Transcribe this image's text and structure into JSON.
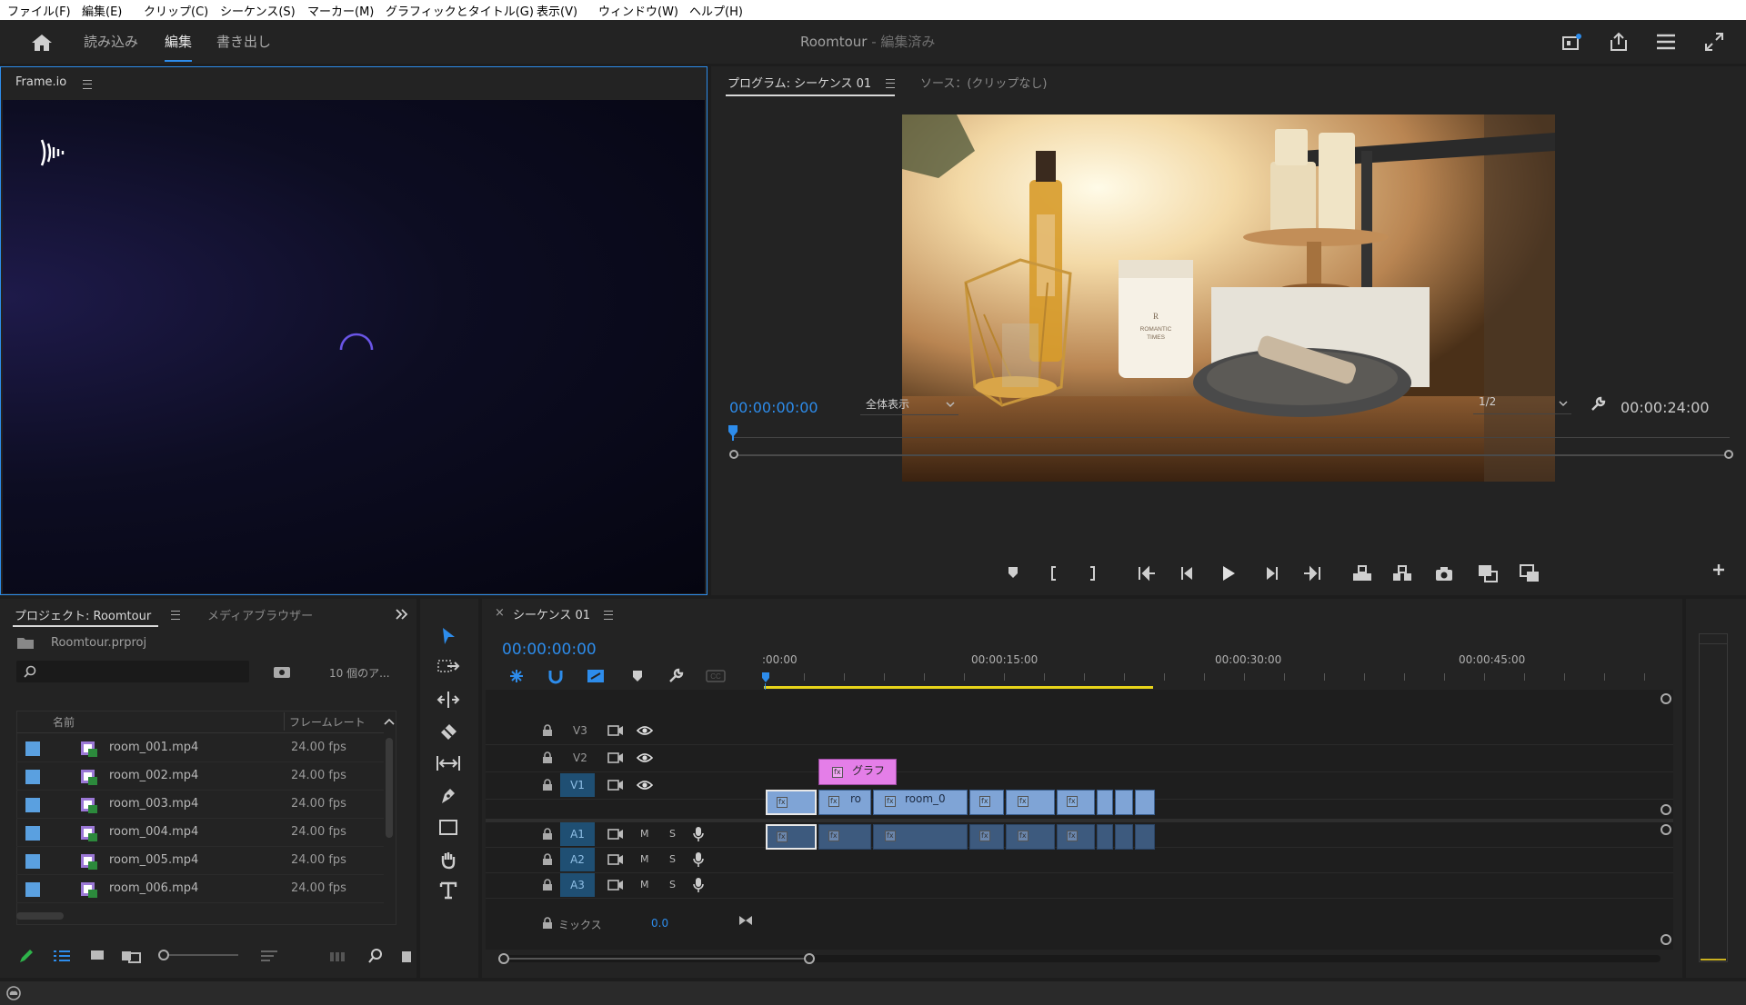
{
  "menu": [
    "ファイル(F)",
    "編集(E)",
    "クリップ(C)",
    "シーケンス(S)",
    "マーカー(M)",
    "グラフィックとタイトル(G)",
    "表示(V)",
    "ウィンドウ(W)",
    "ヘルプ(H)"
  ],
  "header": {
    "tabs": [
      "読み込み",
      "編集",
      "書き出し"
    ],
    "active_tab": "編集",
    "project_title": "Roomtour",
    "project_status": " - 編集済み"
  },
  "frameio": {
    "title": "Frame.io"
  },
  "program": {
    "tab_program": "プログラム: シーケンス 01",
    "tab_source": "ソース：(クリップなし)",
    "timecode": "00:00:00:00",
    "zoom": "全体表示",
    "resolution": "1/2",
    "duration": "00:00:24:00",
    "image_text": [
      "R",
      "ROMANTIC",
      "TIMES"
    ]
  },
  "project": {
    "tab_project": "プロジェクト: Roomtour",
    "tab_media": "メディアブラウザー",
    "file": "Roomtour.prproj",
    "item_count": "10 個のア...",
    "columns": [
      "名前",
      "フレームレート"
    ],
    "items": [
      {
        "name": "room_001.mp4",
        "fps": "24.00 fps"
      },
      {
        "name": "room_002.mp4",
        "fps": "24.00 fps"
      },
      {
        "name": "room_003.mp4",
        "fps": "24.00 fps"
      },
      {
        "name": "room_004.mp4",
        "fps": "24.00 fps"
      },
      {
        "name": "room_005.mp4",
        "fps": "24.00 fps"
      },
      {
        "name": "room_006.mp4",
        "fps": "24.00 fps"
      }
    ]
  },
  "timeline": {
    "tab": "シーケンス 01",
    "timecode": "00:00:00:00",
    "ruler": [
      ":00:00",
      "00:00:15:00",
      "00:00:30:00",
      "00:00:45:00"
    ],
    "video_tracks": [
      "V3",
      "V2",
      "V1"
    ],
    "audio_tracks": [
      "A1",
      "A2",
      "A3"
    ],
    "mix_label": "ミックス",
    "mix_value": "0.0",
    "graphic_clip": "グラフ",
    "clip_labels": [
      "ro",
      "room_0"
    ],
    "m_label": "M",
    "s_label": "S"
  },
  "colors": {
    "accent": "#2d8ceb",
    "audio_clip": "#3d5a7e",
    "video_clip": "#7fa4d6",
    "graphic_clip": "#e47ee8",
    "work_area": "#e8d41a"
  },
  "icons": [
    "home-icon",
    "share-icon",
    "fullscreen-icon",
    "play-icon",
    "wrench-icon",
    "magnet-icon",
    "selection-tool-icon",
    "razor-icon",
    "pen-icon",
    "hand-icon",
    "type-icon",
    "lock-icon",
    "eye-icon",
    "mic-icon",
    "search-icon"
  ]
}
